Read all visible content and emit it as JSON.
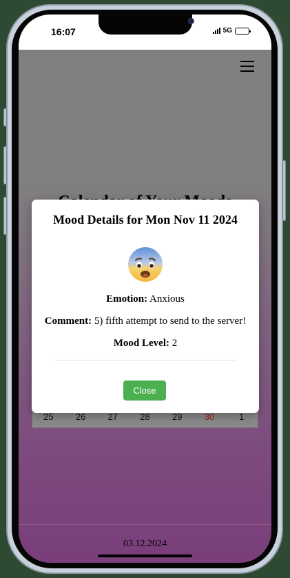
{
  "status_bar": {
    "time": "16:07",
    "network": "5G",
    "icons": [
      "signal-bars-icon",
      "battery-icon"
    ]
  },
  "header": {
    "menu_icon": "hamburger-menu-icon"
  },
  "page": {
    "heading": "Calendar of Your Moods"
  },
  "calendar": {
    "last_row": [
      "25",
      "26",
      "27",
      "28",
      "29",
      "30",
      "1"
    ],
    "sunday_color": "#b01818"
  },
  "modal": {
    "title": "Mood Details for Mon Nov 11 2024",
    "emoji": "anxious-face-icon",
    "emotion_label": "Emotion:",
    "emotion_value": "Anxious",
    "comment_label": "Comment:",
    "comment_value": "5) fifth attempt to send to the server!",
    "mood_level_label": "Mood Level:",
    "mood_level_value": "2",
    "close_label": "Close",
    "close_color": "#4caf50"
  },
  "footer": {
    "date": "03.12.2024"
  },
  "colors": {
    "overlay_top": "#808080",
    "overlay_bottom": "#7a3e7b"
  }
}
